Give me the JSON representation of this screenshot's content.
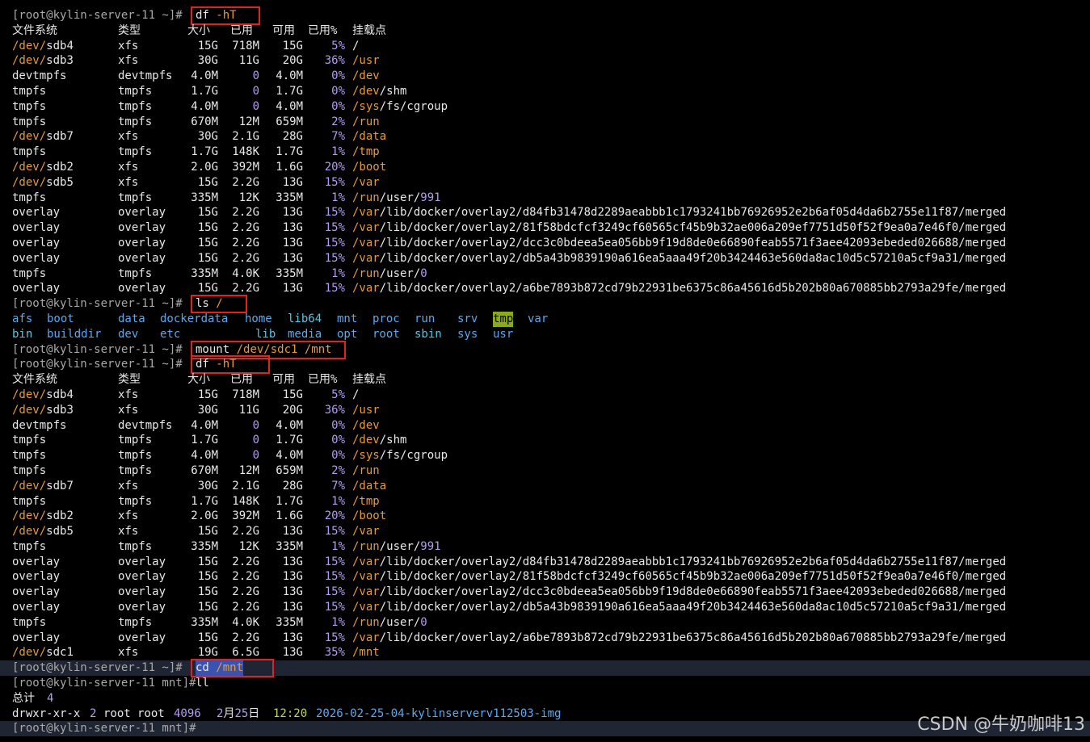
{
  "prompt_root": "[root@kylin-server-11 ~]#",
  "prompt_mnt": "[root@kylin-server-11 mnt]#",
  "cmd_df": "df -hT",
  "cmd_ls": "ls /",
  "cmd_mount": "mount /dev/sdc1 /mnt",
  "cmd_cd": "cd /mnt",
  "cmd_ll": "ll",
  "df_headers": [
    "文件系统",
    "类型",
    "大小",
    "已用",
    "可用",
    "已用%",
    "挂载点"
  ],
  "df1_rows": [
    [
      "/dev/sdb4",
      "xfs",
      "15G",
      "718M",
      "15G",
      "5%",
      "/"
    ],
    [
      "/dev/sdb3",
      "xfs",
      "30G",
      "11G",
      "20G",
      "36%",
      "/usr"
    ],
    [
      "devtmpfs",
      "devtmpfs",
      "4.0M",
      "0",
      "4.0M",
      "0%",
      "/dev"
    ],
    [
      "tmpfs",
      "tmpfs",
      "1.7G",
      "0",
      "1.7G",
      "0%",
      "/dev/shm"
    ],
    [
      "tmpfs",
      "tmpfs",
      "4.0M",
      "0",
      "4.0M",
      "0%",
      "/sys/fs/cgroup"
    ],
    [
      "tmpfs",
      "tmpfs",
      "670M",
      "12M",
      "659M",
      "2%",
      "/run"
    ],
    [
      "/dev/sdb7",
      "xfs",
      "30G",
      "2.1G",
      "28G",
      "7%",
      "/data"
    ],
    [
      "tmpfs",
      "tmpfs",
      "1.7G",
      "148K",
      "1.7G",
      "1%",
      "/tmp"
    ],
    [
      "/dev/sdb2",
      "xfs",
      "2.0G",
      "392M",
      "1.6G",
      "20%",
      "/boot"
    ],
    [
      "/dev/sdb5",
      "xfs",
      "15G",
      "2.2G",
      "13G",
      "15%",
      "/var"
    ],
    [
      "tmpfs",
      "tmpfs",
      "335M",
      "12K",
      "335M",
      "1%",
      "/run/user/991"
    ],
    [
      "overlay",
      "overlay",
      "15G",
      "2.2G",
      "13G",
      "15%",
      "/var/lib/docker/overlay2/d84fb31478d2289aeabbb1c1793241bb76926952e2b6af05d4da6b2755e11f87/merged"
    ],
    [
      "overlay",
      "overlay",
      "15G",
      "2.2G",
      "13G",
      "15%",
      "/var/lib/docker/overlay2/81f58bdcfcf3249cf60565cf45b9b32ae006a209ef7751d50f52f9ea0a7e46f0/merged"
    ],
    [
      "overlay",
      "overlay",
      "15G",
      "2.2G",
      "13G",
      "15%",
      "/var/lib/docker/overlay2/dcc3c0bdeea5ea056bb9f19d8de0e66890feab5571f3aee42093ebeded026688/merged"
    ],
    [
      "overlay",
      "overlay",
      "15G",
      "2.2G",
      "13G",
      "15%",
      "/var/lib/docker/overlay2/db5a43b9839190a616ea5aaa49f20b3424463e560da8ac10d5c57210a5cf9a31/merged"
    ],
    [
      "tmpfs",
      "tmpfs",
      "335M",
      "4.0K",
      "335M",
      "1%",
      "/run/user/0"
    ],
    [
      "overlay",
      "overlay",
      "15G",
      "2.2G",
      "13G",
      "15%",
      "/var/lib/docker/overlay2/a6be7893b872cd79b22931be6375c86a45616d5b202b80a670885bb2793a29fe/merged"
    ]
  ],
  "df2_rows": [
    [
      "/dev/sdb4",
      "xfs",
      "15G",
      "718M",
      "15G",
      "5%",
      "/"
    ],
    [
      "/dev/sdb3",
      "xfs",
      "30G",
      "11G",
      "20G",
      "36%",
      "/usr"
    ],
    [
      "devtmpfs",
      "devtmpfs",
      "4.0M",
      "0",
      "4.0M",
      "0%",
      "/dev"
    ],
    [
      "tmpfs",
      "tmpfs",
      "1.7G",
      "0",
      "1.7G",
      "0%",
      "/dev/shm"
    ],
    [
      "tmpfs",
      "tmpfs",
      "4.0M",
      "0",
      "4.0M",
      "0%",
      "/sys/fs/cgroup"
    ],
    [
      "tmpfs",
      "tmpfs",
      "670M",
      "12M",
      "659M",
      "2%",
      "/run"
    ],
    [
      "/dev/sdb7",
      "xfs",
      "30G",
      "2.1G",
      "28G",
      "7%",
      "/data"
    ],
    [
      "tmpfs",
      "tmpfs",
      "1.7G",
      "148K",
      "1.7G",
      "1%",
      "/tmp"
    ],
    [
      "/dev/sdb2",
      "xfs",
      "2.0G",
      "392M",
      "1.6G",
      "20%",
      "/boot"
    ],
    [
      "/dev/sdb5",
      "xfs",
      "15G",
      "2.2G",
      "13G",
      "15%",
      "/var"
    ],
    [
      "tmpfs",
      "tmpfs",
      "335M",
      "12K",
      "335M",
      "1%",
      "/run/user/991"
    ],
    [
      "overlay",
      "overlay",
      "15G",
      "2.2G",
      "13G",
      "15%",
      "/var/lib/docker/overlay2/d84fb31478d2289aeabbb1c1793241bb76926952e2b6af05d4da6b2755e11f87/merged"
    ],
    [
      "overlay",
      "overlay",
      "15G",
      "2.2G",
      "13G",
      "15%",
      "/var/lib/docker/overlay2/81f58bdcfcf3249cf60565cf45b9b32ae006a209ef7751d50f52f9ea0a7e46f0/merged"
    ],
    [
      "overlay",
      "overlay",
      "15G",
      "2.2G",
      "13G",
      "15%",
      "/var/lib/docker/overlay2/dcc3c0bdeea5ea056bb9f19d8de0e66890feab5571f3aee42093ebeded026688/merged"
    ],
    [
      "overlay",
      "overlay",
      "15G",
      "2.2G",
      "13G",
      "15%",
      "/var/lib/docker/overlay2/db5a43b9839190a616ea5aaa49f20b3424463e560da8ac10d5c57210a5cf9a31/merged"
    ],
    [
      "tmpfs",
      "tmpfs",
      "335M",
      "4.0K",
      "335M",
      "1%",
      "/run/user/0"
    ],
    [
      "overlay",
      "overlay",
      "15G",
      "2.2G",
      "13G",
      "15%",
      "/var/lib/docker/overlay2/a6be7893b872cd79b22931be6375c86a45616d5b202b80a670885bb2793a29fe/merged"
    ],
    [
      "/dev/sdc1",
      "xfs",
      "19G",
      "6.5G",
      "13G",
      "35%",
      "/mnt"
    ]
  ],
  "ls_row1": [
    "afs",
    "boot",
    "data",
    "dockerdata",
    "home",
    "lib64",
    "mnt",
    "proc",
    "run",
    "srv",
    "tmp",
    "var"
  ],
  "ls_row2": [
    "bin",
    "builddir",
    "dev",
    "etc",
    "lib",
    "media",
    "opt",
    "root",
    "sbin",
    "sys",
    "usr"
  ],
  "ll_total": "总计 4",
  "ll_entry": {
    "perms": "drwxr-xr-x",
    "links": "2",
    "owner": "root",
    "group": "root",
    "size": "4096",
    "month": "2月",
    "day": "25日",
    "time": "12:20",
    "name": "2026-02-25-04-kylinserverv112503-img"
  },
  "watermark": "CSDN @牛奶咖啡13",
  "colors": {
    "background": "#000000",
    "text": "#e8e8e8",
    "path_orange": "#e89a3c",
    "number_purple": "#b49cf0",
    "dir_blue": "#5aa9f0",
    "link_cyan": "#55c6e6",
    "time_green": "#b8d85a",
    "annotation_red": "#e0231f"
  }
}
